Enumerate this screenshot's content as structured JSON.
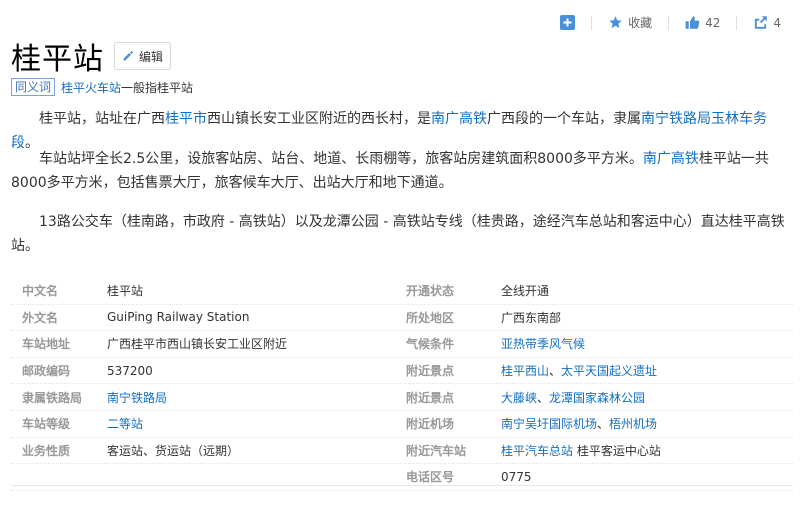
{
  "toolbar": {
    "collect_label": "收藏",
    "like_count": "42",
    "share_count": "4"
  },
  "title": "桂平站",
  "edit_label": "编辑",
  "synonym": {
    "tag": "同义词",
    "link": "桂平火车站",
    "suffix": "一般指桂平站"
  },
  "paragraphs": {
    "p1": {
      "t1": "桂平站，站址在广西",
      "l1": "桂平市",
      "t2": "西山镇长安工业区附近的西长村，是",
      "l2": "南广高铁",
      "t3": "广西段的一个车站，隶属",
      "l3": "南宁铁路局",
      "l4": "玉林车务段",
      "t4": "。"
    },
    "p2": {
      "t1": "车站站坪全长2.5公里，设旅客站房、站台、地道、长雨棚等，旅客站房建筑面积8000多平方米。",
      "l1": "南广高铁",
      "t2": "桂平站一共8000多平方米，包括售票大厅，旅客候车大厅、出站大厅和地下通道。"
    },
    "p3": {
      "t1": "13路公交车（桂南路，市政府 - 高铁站）以及龙潭公园 - 高铁站专线（桂贵路，途经汽车总站和客运中心）直达桂平高铁站。"
    }
  },
  "info": {
    "left": [
      {
        "key": "中文名",
        "value": "桂平站",
        "link": false
      },
      {
        "key": "外文名",
        "value": "GuiPing Railway Station",
        "link": false
      },
      {
        "key": "车站地址",
        "value": "广西桂平市西山镇长安工业区附近",
        "link": false
      },
      {
        "key": "邮政编码",
        "value": "537200",
        "link": false
      },
      {
        "key": "隶属铁路局",
        "value": "南宁铁路局",
        "link": true
      },
      {
        "key": "车站等级",
        "value": "二等站",
        "link": true
      },
      {
        "key": "业务性质",
        "value": "客运站、货运站（远期）",
        "link": false
      }
    ],
    "right": [
      {
        "key": "开通状态",
        "parts": [
          {
            "text": "全线开通",
            "link": false
          }
        ]
      },
      {
        "key": "所处地区",
        "parts": [
          {
            "text": "广西东南部",
            "link": false
          }
        ]
      },
      {
        "key": "气候条件",
        "parts": [
          {
            "text": "亚热带季风气候",
            "link": true
          }
        ]
      },
      {
        "key": "附近景点",
        "parts": [
          {
            "text": "桂平西山",
            "link": true
          },
          {
            "text": "、",
            "link": false
          },
          {
            "text": "太平天国起义遗址",
            "link": true
          }
        ]
      },
      {
        "key": "附近景点",
        "parts": [
          {
            "text": "大藤峡",
            "link": true
          },
          {
            "text": "、",
            "link": false
          },
          {
            "text": "龙潭国家森林公园",
            "link": true
          }
        ]
      },
      {
        "key": "附近机场",
        "parts": [
          {
            "text": "南宁吴圩国际机场",
            "link": true
          },
          {
            "text": "、",
            "link": false
          },
          {
            "text": "梧州机场",
            "link": true
          }
        ]
      },
      {
        "key": "附近汽车站",
        "parts": [
          {
            "text": "桂平汽车总站",
            "link": true
          },
          {
            "text": " 桂平客运中心站",
            "link": false
          }
        ]
      },
      {
        "key": "电话区号",
        "parts": [
          {
            "text": "0775",
            "link": false
          }
        ]
      }
    ]
  }
}
